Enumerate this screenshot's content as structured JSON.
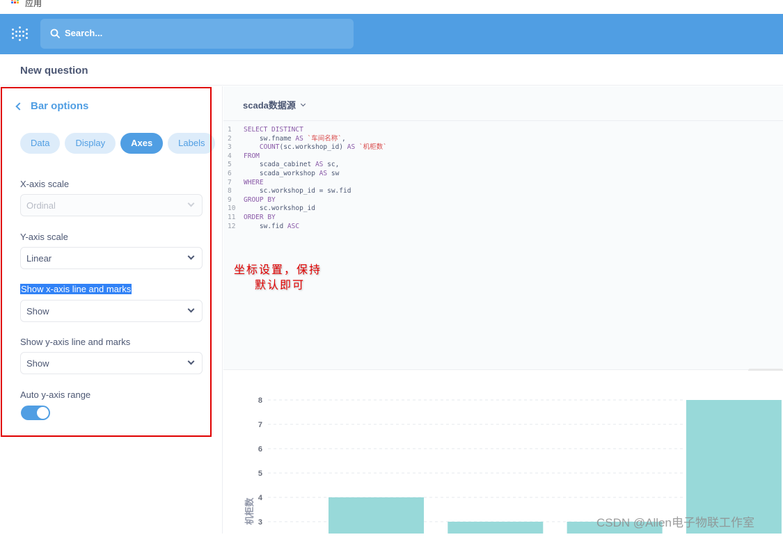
{
  "browser": {
    "apps_label": "应用"
  },
  "header": {
    "search_placeholder": "Search..."
  },
  "page": {
    "title": "New question"
  },
  "sidebar": {
    "back_label": "Bar options",
    "tabs": [
      {
        "label": "Data",
        "active": false
      },
      {
        "label": "Display",
        "active": false
      },
      {
        "label": "Axes",
        "active": true
      },
      {
        "label": "Labels",
        "active": false
      }
    ],
    "x_axis_scale": {
      "label": "X-axis scale",
      "value": "Ordinal",
      "disabled": true
    },
    "y_axis_scale": {
      "label": "Y-axis scale",
      "value": "Linear"
    },
    "show_x_axis": {
      "label": "Show x-axis line and marks",
      "value": "Show"
    },
    "show_y_axis": {
      "label": "Show y-axis line and marks",
      "value": "Show"
    },
    "auto_y_range": {
      "label": "Auto y-axis range",
      "enabled": true
    }
  },
  "editor": {
    "database": "scada数据源",
    "sql_lines": [
      "SELECT DISTINCT",
      "    sw.fname AS `车间名称`,",
      "    COUNT(sc.workshop_id) AS `机柜数`",
      "FROM",
      "    scada_cabinet AS sc,",
      "    scada_workshop AS sw",
      "WHERE",
      "    sc.workshop_id = sw.fid",
      "GROUP BY",
      "    sc.workshop_id",
      "ORDER BY",
      "    sw.fid ASC"
    ]
  },
  "annotation": {
    "line1": "坐标设置，保持",
    "line2": "默认即可"
  },
  "watermark": "CSDN @Allen电子物联工作室",
  "colors": {
    "brand": "#509ee3",
    "bar": "#98d9d9",
    "annotation": "#e00000"
  },
  "chart_data": {
    "type": "bar",
    "ylabel": "机柜数",
    "y_ticks": [
      3,
      4,
      5,
      6,
      7,
      8
    ],
    "ylim": [
      3,
      8
    ],
    "values": [
      4,
      3,
      3,
      8
    ],
    "grid": true
  }
}
